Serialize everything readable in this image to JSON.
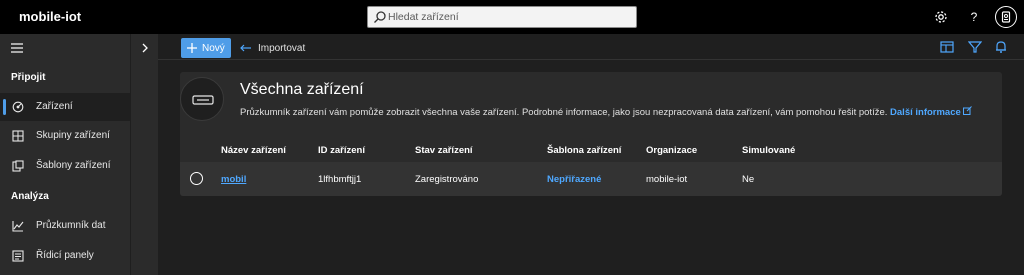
{
  "app": {
    "title": "mobile-iot"
  },
  "search": {
    "placeholder": "Hledat zařízení"
  },
  "top_icons": [
    "gear-icon",
    "help-icon",
    "user-badge-icon"
  ],
  "sidebar": {
    "sections": [
      {
        "label": "Připojit"
      },
      {
        "label": "Analýza"
      }
    ],
    "items": [
      {
        "label": "Zařízení",
        "icon": "devices-icon",
        "active": true
      },
      {
        "label": "Skupiny zařízení",
        "icon": "device-groups-icon"
      },
      {
        "label": "Šablony zařízení",
        "icon": "device-templates-icon"
      },
      {
        "label": "Průzkumník dat",
        "icon": "data-explorer-icon"
      },
      {
        "label": "Řídicí panely",
        "icon": "dashboards-icon"
      }
    ]
  },
  "commands": {
    "new_label": "Nový",
    "import_label": "Importovat"
  },
  "main": {
    "heading": "Všechna zařízení",
    "description": "Průzkumník zařízení vám pomůže zobrazit všechna vaše zařízení. Podrobné informace, jako jsou nezpracovaná data zařízení, vám pomohou řešit potíže.",
    "more_link": "Další informace"
  },
  "table": {
    "columns": [
      "Název zařízení",
      "ID zařízení",
      "Stav zařízení",
      "Šablona zařízení",
      "Organizace",
      "Simulované"
    ],
    "rows": [
      {
        "name": "mobil",
        "id": "1lfhbmftjj1",
        "status": "Zaregistrováno",
        "template": "Nepřiřazené",
        "organization": "mobile-iot",
        "simulated": "Ne"
      }
    ]
  },
  "colors": {
    "accent": "#4f9de8",
    "link": "#4fa8ff",
    "topbar": "#000000",
    "sidebar": "#2b2b2b",
    "background": "#1f1f1f"
  }
}
